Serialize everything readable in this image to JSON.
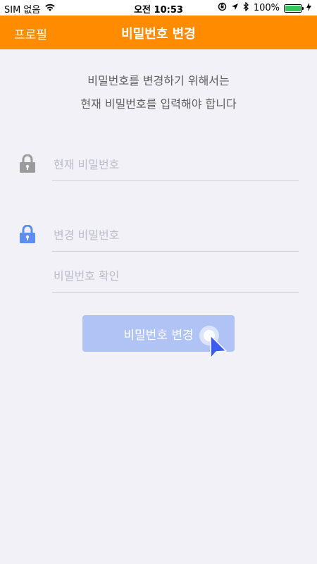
{
  "status": {
    "carrier": "SIM 없음",
    "time": "오전 10:53",
    "battery": "100%",
    "battery_color": "#34C759"
  },
  "nav": {
    "back_label": "프로필",
    "title": "비밀번호 변경",
    "bg_color": "#FF8C00"
  },
  "intro": {
    "line1": "비밀번호를 변경하기 위해서는",
    "line2": "현재 비밀번호를 입력해야 합니다"
  },
  "fields": {
    "current_placeholder": "현재 비밀번호",
    "new_placeholder": "변경 비밀번호",
    "confirm_placeholder": "비밀번호 확인"
  },
  "icons": {
    "current_lock": "lock-icon",
    "new_lock": "lock-icon",
    "gray": "#9B9B9B",
    "blue": "#5E8DF0"
  },
  "submit": {
    "label": "비밀번호 변경",
    "color": "#AFC4F4"
  }
}
